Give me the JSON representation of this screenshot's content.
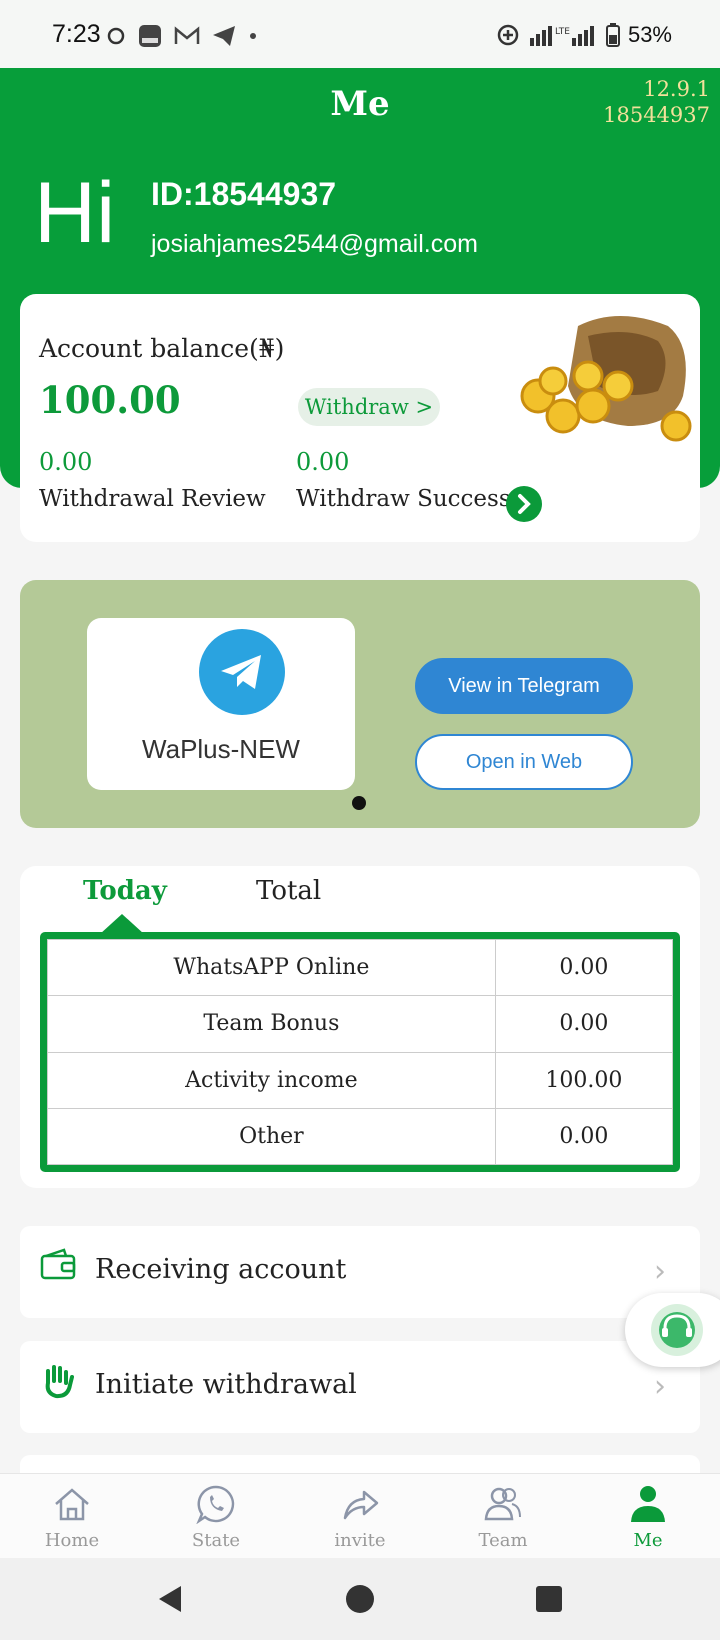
{
  "status_bar": {
    "time": "7:23",
    "battery": "53%"
  },
  "header": {
    "title": "Me",
    "version": "12.9.1",
    "version_id": "18544937",
    "greeting": "Hi",
    "user_id": "ID:18544937",
    "email": "josiahjames2544@gmail.com"
  },
  "balance": {
    "label": "Account balance(₦)",
    "amount": "100.00",
    "withdraw_button": "Withdraw >",
    "review_value": "0.00",
    "review_label": "Withdrawal Review",
    "success_value": "0.00",
    "success_label": "Withdraw Success"
  },
  "banner": {
    "channel_name": "WaPlus-NEW",
    "view_button": "View in Telegram",
    "web_button": "Open in Web"
  },
  "stats": {
    "tabs": [
      "Today",
      "Total"
    ],
    "active_tab": "Today",
    "rows": [
      {
        "label": "WhatsAPP Online",
        "value": "0.00"
      },
      {
        "label": "Team Bonus",
        "value": "0.00"
      },
      {
        "label": "Activity income",
        "value": "100.00"
      },
      {
        "label": "Other",
        "value": "0.00"
      }
    ]
  },
  "menu": [
    {
      "label": "Receiving account",
      "icon": "wallet-icon"
    },
    {
      "label": "Initiate withdrawal",
      "icon": "hand-icon"
    }
  ],
  "tabbar": [
    {
      "label": "Home",
      "icon": "home-icon"
    },
    {
      "label": "State",
      "icon": "whatsapp-icon"
    },
    {
      "label": "invite",
      "icon": "share-icon"
    },
    {
      "label": "Team",
      "icon": "team-icon"
    },
    {
      "label": "Me",
      "icon": "person-icon"
    }
  ],
  "colors": {
    "brand_green": "#079e3a",
    "version_yellow": "#f3e19b",
    "telegram_blue": "#2f86d3"
  }
}
